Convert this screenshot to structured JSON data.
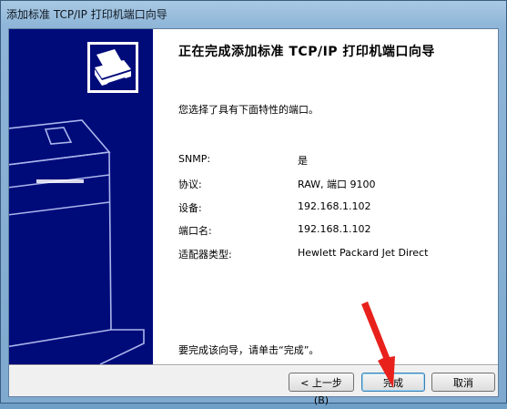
{
  "window": {
    "title": "添加标准 TCP/IP 打印机端口向导"
  },
  "wizard": {
    "heading": "正在完成添加标准 TCP/IP 打印机端口向导",
    "intro": "您选择了具有下面特性的端口。",
    "properties": [
      {
        "label": "SNMP:",
        "value": "是"
      },
      {
        "label": "协议:",
        "value": "RAW, 端口 9100"
      },
      {
        "label": "设备:",
        "value": "192.168.1.102"
      },
      {
        "label": "端口名:",
        "value": "192.168.1.102"
      },
      {
        "label": "适配器类型:",
        "value": "Hewlett Packard Jet Direct"
      }
    ],
    "hint": "要完成该向导，请单击“完成”。"
  },
  "buttons": {
    "back": "< 上一步(B)",
    "finish": "完成",
    "cancel": "取消"
  },
  "colors": {
    "banner": "#000b7a",
    "arrow": "#e8211c"
  },
  "icons": [
    "printer-wizard-icon",
    "printer-illustration",
    "red-arrow-annotation"
  ]
}
